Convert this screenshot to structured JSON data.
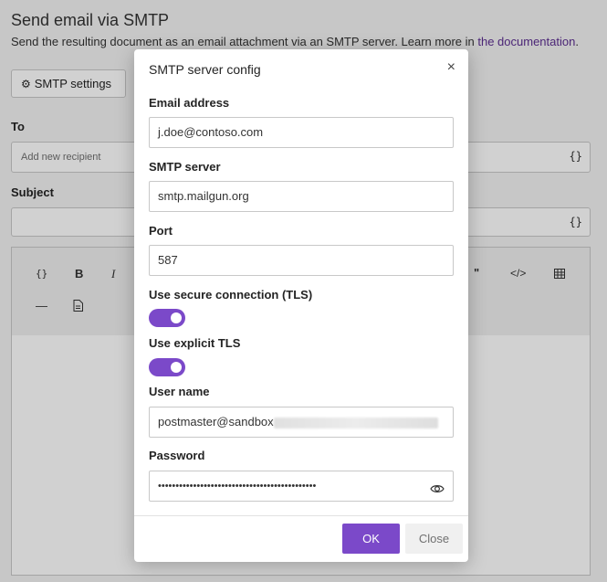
{
  "page": {
    "title": "Send email via SMTP",
    "description": "Send the resulting document as an email attachment via an SMTP server. Learn more in ",
    "doc_link": "the documentation",
    "doc_link_suffix": ".",
    "smtp_settings_label": "SMTP settings",
    "to_label": "To",
    "to_placeholder": "Add new recipient",
    "subject_label": "Subject",
    "brace_glyph": "{}"
  },
  "editor_toolbar": {
    "row1": [
      "{}",
      "B",
      "I",
      "\"",
      "</>",
      "table"
    ],
    "row2": [
      "—",
      "doc"
    ]
  },
  "dialog": {
    "title": "SMTP server config",
    "close_glyph": "×",
    "email_label": "Email address",
    "email_value": "j.doe@contoso.com",
    "server_label": "SMTP server",
    "server_value": "smtp.mailgun.org",
    "port_label": "Port",
    "port_value": "587",
    "tls_label": "Use secure connection (TLS)",
    "tls_enabled": true,
    "explicit_tls_label": "Use explicit TLS",
    "explicit_tls_enabled": true,
    "username_label": "User name",
    "username_value": "postmaster@sandbox",
    "password_label": "Password",
    "password_value": "•••••••••••••••••••••••••••••••••••••••••••••",
    "ok_label": "OK",
    "close_label": "Close"
  },
  "colors": {
    "accent": "#7b49c9",
    "link": "#5c2e91"
  }
}
